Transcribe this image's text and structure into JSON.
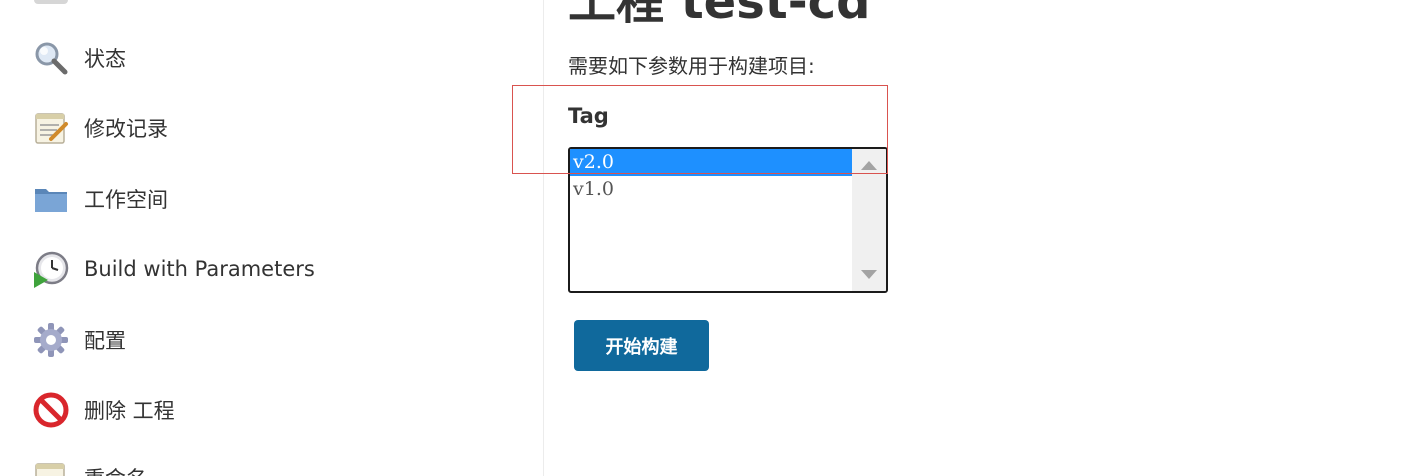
{
  "project": {
    "title": "工程 test-cd"
  },
  "sidebar": {
    "items": [
      {
        "label": "状态",
        "icon": "magnifier-icon"
      },
      {
        "label": "修改记录",
        "icon": "notepad-icon"
      },
      {
        "label": "工作空间",
        "icon": "folder-icon"
      },
      {
        "label": "Build with Parameters",
        "icon": "clock-play-icon"
      },
      {
        "label": "配置",
        "icon": "gear-icon"
      },
      {
        "label": "删除 工程",
        "icon": "no-entry-icon"
      },
      {
        "label": "重命名",
        "icon": "notepad-icon"
      }
    ]
  },
  "form": {
    "description": "需要如下参数用于构建项目:",
    "parameter_name": "Tag",
    "options": [
      "v2.0",
      "v1.0"
    ],
    "selected": "v2.0",
    "build_button_label": "开始构建"
  },
  "colors": {
    "selected_option": "#1e90ff",
    "build_button": "#10699c",
    "highlight_border": "#d9534f"
  }
}
